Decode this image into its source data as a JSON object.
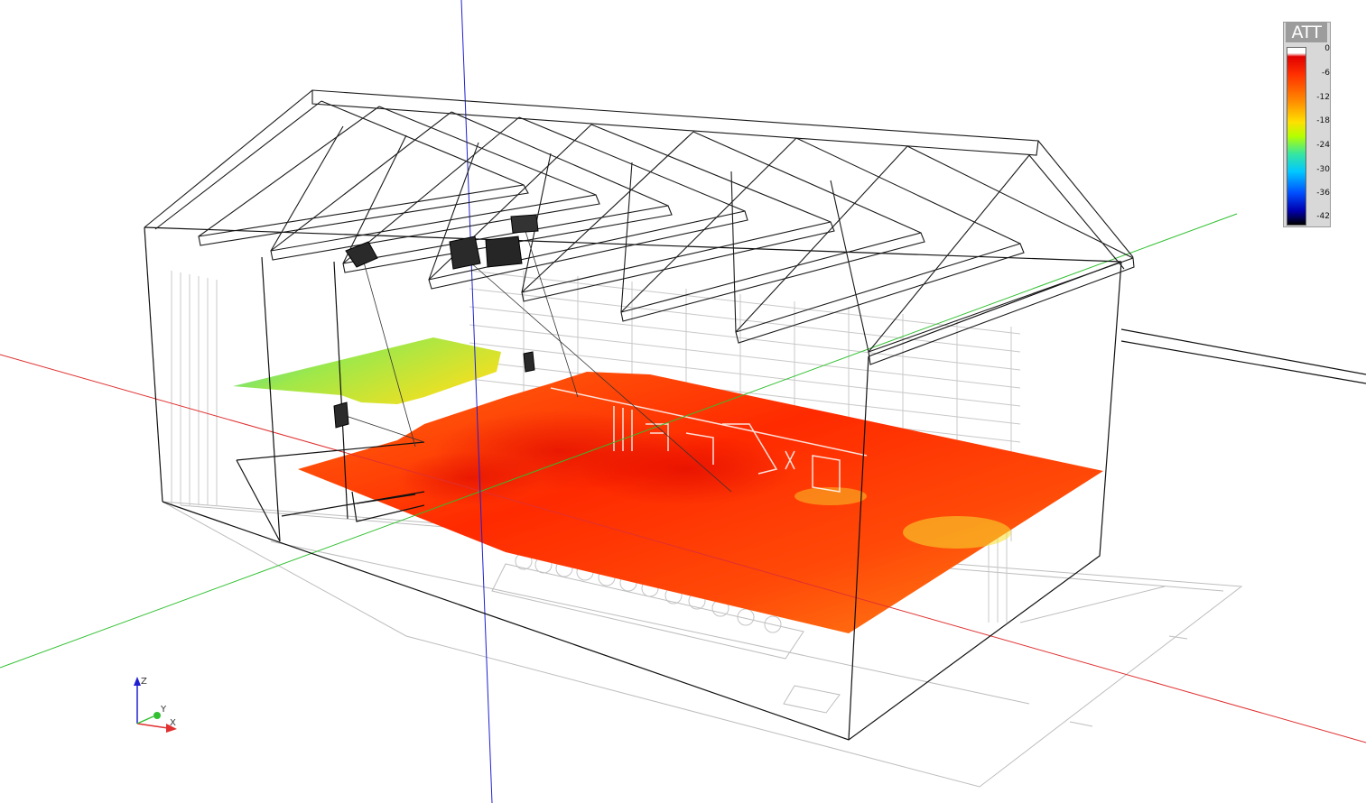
{
  "legend": {
    "title": "ATT",
    "ticks": [
      "0",
      "-6",
      "-12",
      "-18",
      "-24",
      "-30",
      "-36",
      "-42"
    ]
  },
  "axis_triad": {
    "z_label": "Z",
    "y_label": "Y",
    "x_label": "X"
  },
  "colors": {
    "x_axis": "#e03030",
    "y_axis": "#30c030",
    "z_axis": "#2020d0",
    "wireframe": "#111111",
    "ghost_lines": "#b8b8b8"
  },
  "icons": [
    "speaker-icon"
  ]
}
